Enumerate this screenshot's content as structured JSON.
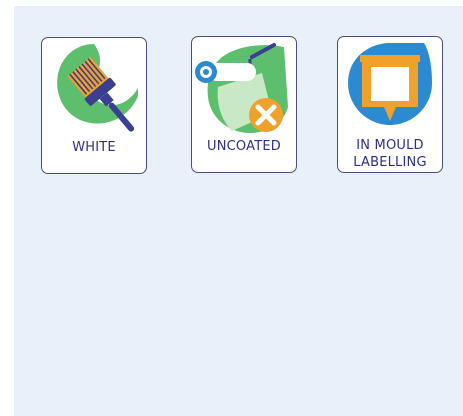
{
  "features": [
    {
      "label_lines": [
        "WHITE"
      ],
      "icon": "paint-brush-icon"
    },
    {
      "label_lines": [
        "UNCOATED"
      ],
      "icon": "paint-roller-crossed-icon"
    },
    {
      "label_lines": [
        "IN MOULD",
        "LABELLING"
      ],
      "icon": "label-tag-icon"
    }
  ],
  "colors": {
    "green": "#5dbf6e",
    "light_green": "#c9e8c6",
    "navy": "#3a3f8f",
    "orange": "#f0a12c",
    "blue": "#2b8ad0",
    "label": "#2e3184",
    "panel_bg": "#e8f0f9"
  }
}
